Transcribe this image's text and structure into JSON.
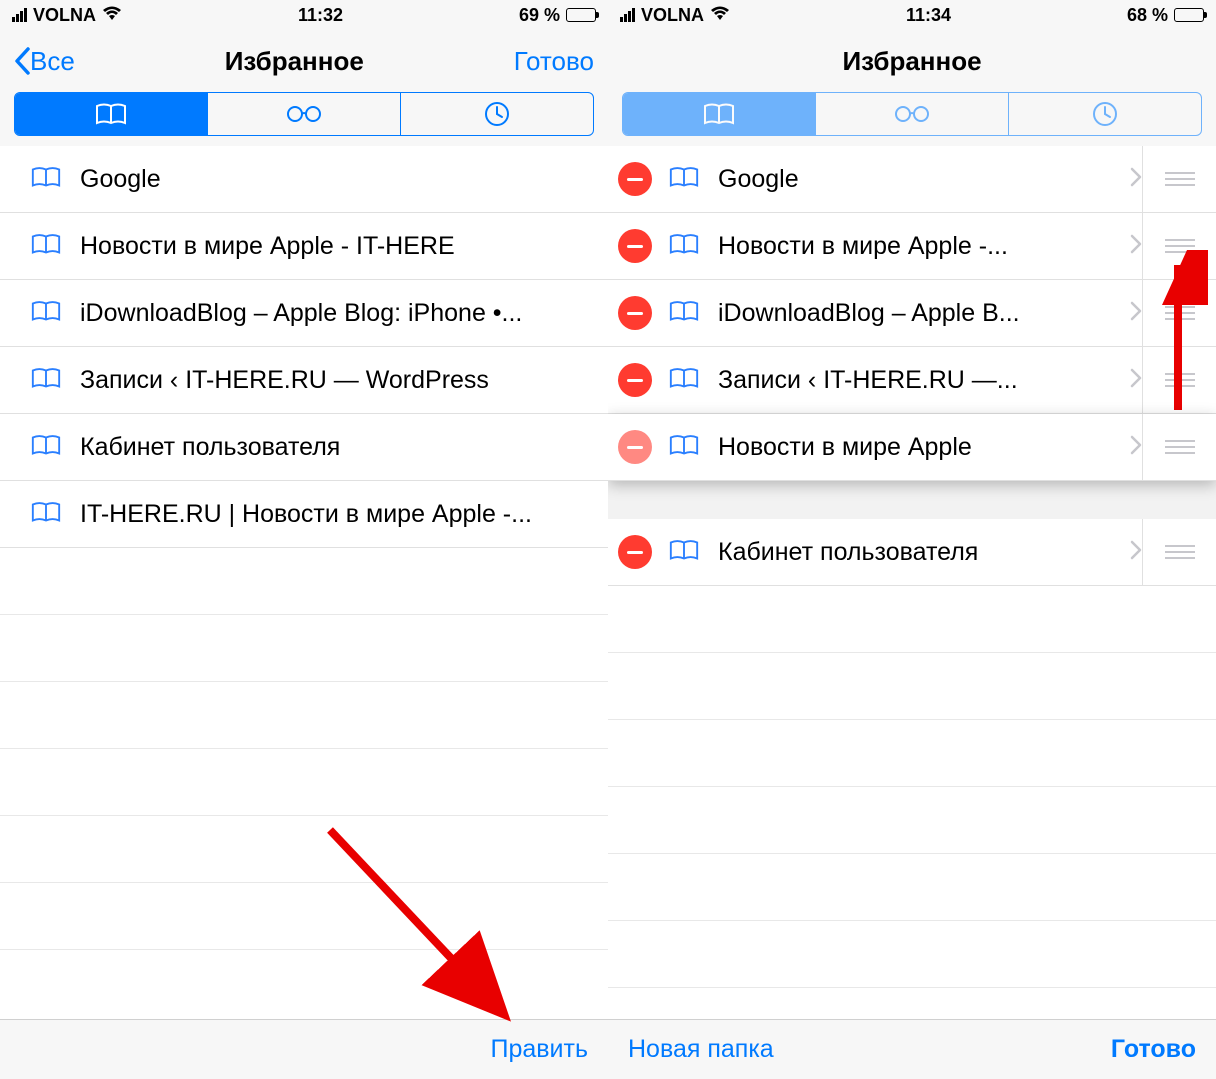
{
  "colors": {
    "accent": "#007aff",
    "delete": "#ff3b30",
    "annotation": "#e80000"
  },
  "left": {
    "status": {
      "carrier": "VOLNA",
      "time": "11:32",
      "battery_text": "69 %",
      "battery_pct": 69
    },
    "nav": {
      "back": "Все",
      "title": "Избранное",
      "done": "Готово"
    },
    "segmented": {
      "active_index": 0
    },
    "bookmarks": [
      {
        "label": "Google"
      },
      {
        "label": "Новости в мире Apple - IT-HERE"
      },
      {
        "label": "iDownloadBlog – Apple Blog: iPhone •..."
      },
      {
        "label": "Записи ‹ IT-HERE.RU — WordPress"
      },
      {
        "label": "Кабинет пользователя"
      },
      {
        "label": "IT-HERE.RU | Новости в мире Apple -..."
      }
    ],
    "toolbar": {
      "edit": "Править"
    }
  },
  "right": {
    "status": {
      "carrier": "VOLNA",
      "time": "11:34",
      "battery_text": "68 %",
      "battery_pct": 68
    },
    "nav": {
      "title": "Избранное"
    },
    "segmented": {
      "active_index": 0
    },
    "bookmarks": [
      {
        "label": "Google"
      },
      {
        "label": "Новости в мире Apple -..."
      },
      {
        "label": "iDownloadBlog – Apple B..."
      },
      {
        "label": "Записи ‹ IT-HERE.RU —..."
      },
      {
        "label": "Новости в мире Apple",
        "dragging": true
      },
      {
        "label": "Кабинет пользователя",
        "gap_before": true
      }
    ],
    "toolbar": {
      "new_folder": "Новая папка",
      "done": "Готово"
    }
  }
}
